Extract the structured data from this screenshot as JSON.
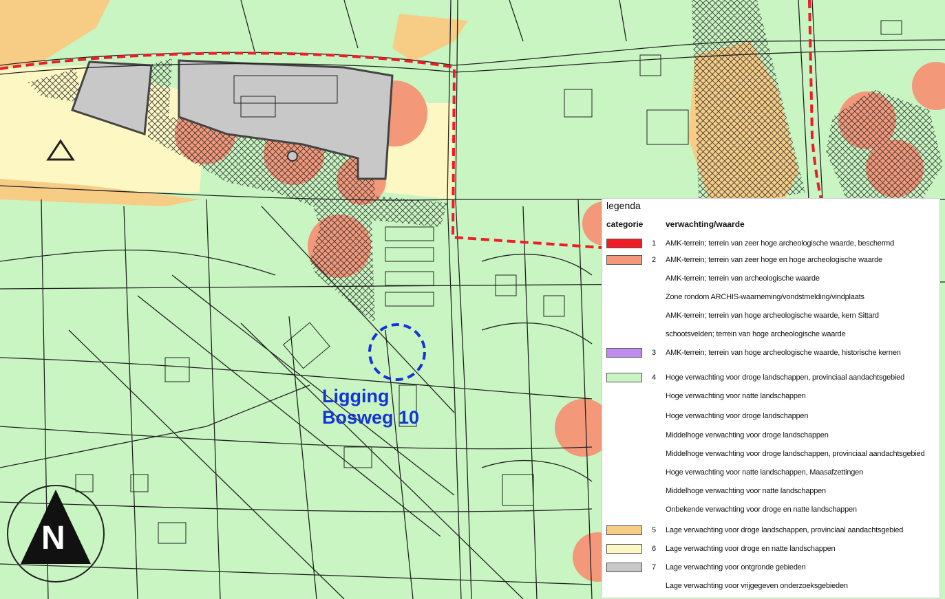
{
  "location_label": [
    "Ligging",
    "Bosweg 10"
  ],
  "north_label": "N",
  "legend": {
    "title": "legenda",
    "col_category": "categorie",
    "col_value": "verwachting/waarde",
    "rows": [
      {
        "cat": "1",
        "text": "AMK-terrein; terrein van zeer hoge archeologische waarde, beschermd",
        "color": "#ee1c25"
      },
      {
        "cat": "2",
        "text": "AMK-terrein; terrein van zeer hoge en hoge archeologische waarde",
        "color": "#f4987a"
      },
      {
        "cat": "",
        "text": "AMK-terrein; terrein van archeologische waarde",
        "color": ""
      },
      {
        "cat": "",
        "text": "Zone rondom ARCHIS-waarneming/vondstmelding/vindplaats",
        "color": ""
      },
      {
        "cat": "",
        "text": "AMK-terrein; terrein van hoge archeologische waarde, kern Sittard",
        "color": ""
      },
      {
        "cat": "",
        "text": "schootsvelden; terrein van hoge archeologische waarde",
        "color": ""
      },
      {
        "cat": "3",
        "text": "AMK-terrein; terrein van hoge archeologische waarde, historische kernen",
        "color": "#c08cf2"
      },
      {
        "cat": "4",
        "text": "Hoge verwachting voor droge landschappen, provinciaal aandachtsgebied",
        "color": "#c8f5c2"
      },
      {
        "cat": "",
        "text": "Hoge verwachting voor natte landschappen",
        "color": ""
      },
      {
        "cat": "",
        "text": "Hoge verwachting voor droge landschappen",
        "color": ""
      },
      {
        "cat": "",
        "text": "Middelhoge verwachting voor droge landschappen",
        "color": ""
      },
      {
        "cat": "",
        "text": "Middelhoge verwachting voor droge landschappen, provinciaal aandachtsgebied",
        "color": ""
      },
      {
        "cat": "",
        "text": "Hoge verwachting voor natte landschappen, Maasafzettingen",
        "color": ""
      },
      {
        "cat": "",
        "text": "Middelhoge verwachting voor natte landschappen",
        "color": ""
      },
      {
        "cat": "",
        "text": "Onbekende verwachting voor droge en natte landschappen",
        "color": ""
      },
      {
        "cat": "5",
        "text": "Lage verwachting voor droge landschappen, provinciaal aandachtsgebied",
        "color": "#f7cd85"
      },
      {
        "cat": "6",
        "text": "Lage verwachting voor droge en natte landschappen",
        "color": "#fdf7c3"
      },
      {
        "cat": "7",
        "text": "Lage verwachting voor ontgronde gebieden",
        "color": "#c8c8c8"
      },
      {
        "cat": "",
        "text": "Lage verwachting voor vrijgegeven onderzoeksgebieden",
        "color": ""
      }
    ]
  },
  "colors": {
    "green": "#c8f5c2",
    "salmon": "#f4987a",
    "orange": "#f7cd85",
    "yellow": "#fdf7c3",
    "grey": "#c8c8c8",
    "boundary": "#ee1c25",
    "location_marker": "#1433d9"
  }
}
